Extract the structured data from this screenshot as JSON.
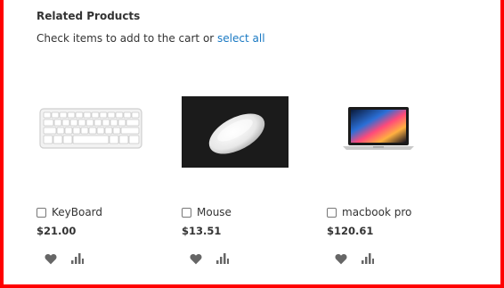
{
  "section": {
    "title": "Related Products",
    "subtitle_prefix": "Check items to add to the cart or",
    "select_all_label": "select all"
  },
  "products": [
    {
      "name": "KeyBoard",
      "price": "$21.00",
      "image_icon": "keyboard-image"
    },
    {
      "name": "Mouse",
      "price": "$13.51",
      "image_icon": "mouse-image"
    },
    {
      "name": "macbook pro",
      "price": "$120.61",
      "image_icon": "laptop-image"
    }
  ],
  "icons": {
    "wishlist": "heart-icon",
    "compare": "compare-icon"
  },
  "colors": {
    "frame_border": "#ff0000",
    "link": "#1979c3",
    "text": "#333333",
    "icon": "#666666"
  }
}
